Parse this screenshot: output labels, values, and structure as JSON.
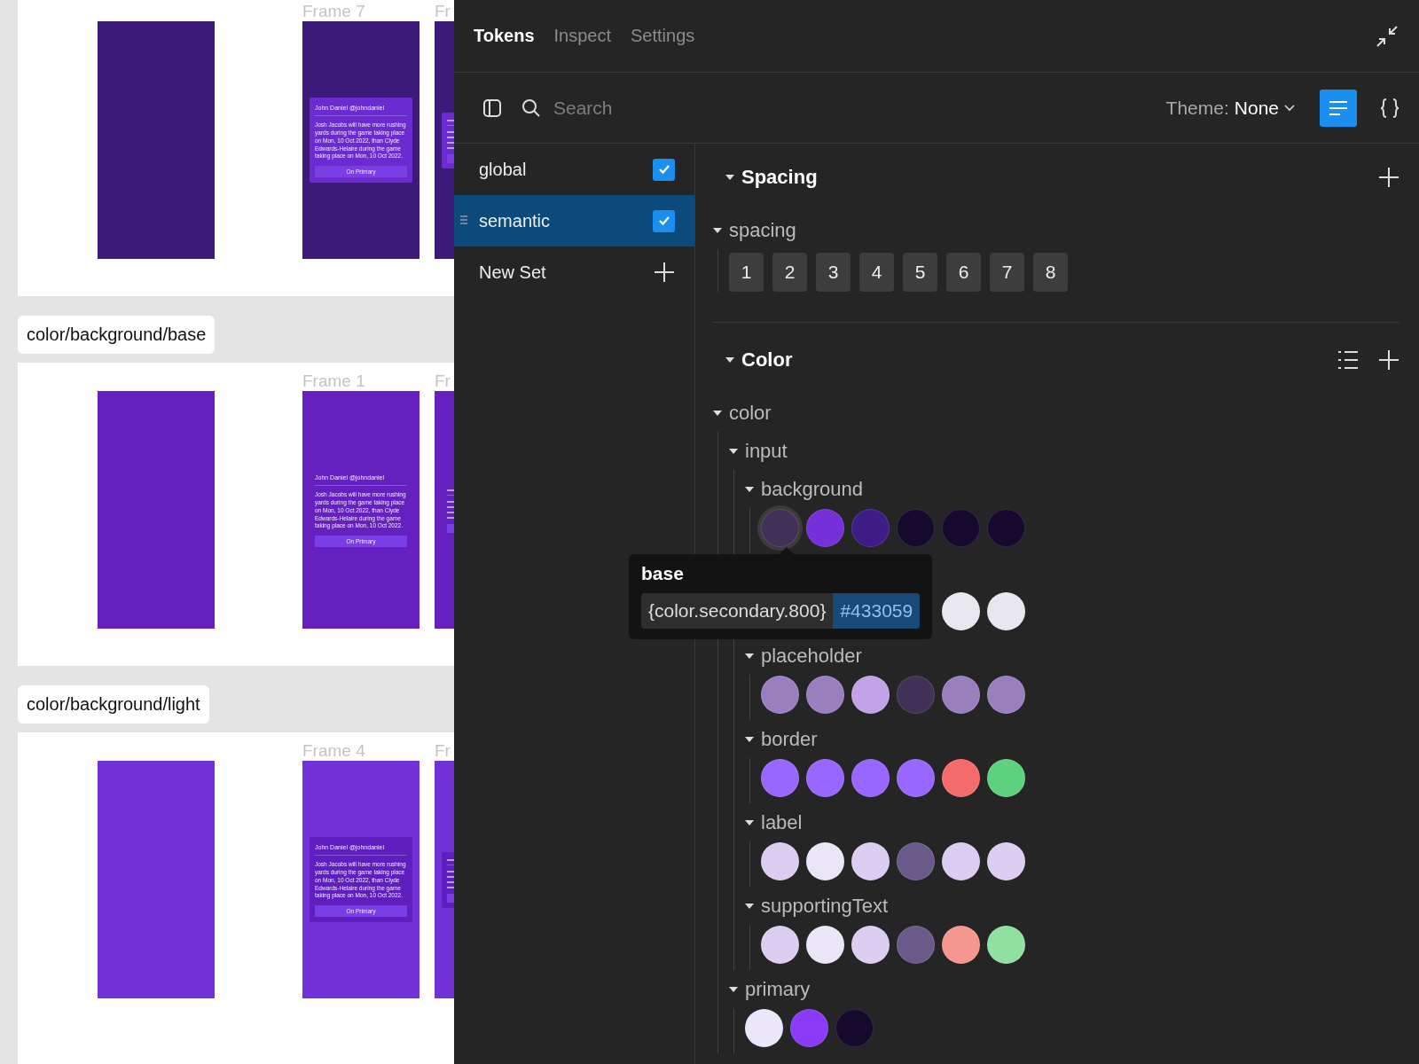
{
  "canvas": {
    "sections": [
      {
        "color": "#3c1a7a",
        "card": {
          "color": "#6a2bd0"
        },
        "frames": [
          {
            "label": "Frame 7",
            "card": {
              "author": "John Daniel @johndaniel",
              "body": "Josh Jacobs will have more rushing yards during the game taking place on Mon, 10 Oct 2022, than Clyde Edwards-Helaire during the game taking place on Mon, 10 Oct 2022.",
              "button": "On Primary"
            }
          },
          {
            "label": "Fr"
          }
        ]
      },
      {
        "label": "color/background/base",
        "color": "#6520c0",
        "card": {
          "color": "#6520c0"
        },
        "frames": [
          {
            "label": "Frame 1",
            "card": {
              "author": "John Daniel @johndaniel",
              "body": "Josh Jacobs will have more rushing yards during the game taking place on Mon, 10 Oct 2022, than Clyde Edwards-Helaire during the game taking place on Mon, 10 Oct 2022.",
              "button": "On Primary"
            }
          },
          {
            "label": "Fr"
          }
        ]
      },
      {
        "label": "color/background/light",
        "color": "#7232d8",
        "card": {
          "color": "#5e1fbe"
        },
        "frames": [
          {
            "label": "Frame 4",
            "card": {
              "author": "John Daniel @johndaniel",
              "body": "Josh Jacobs will have more rushing yards during the game taking place on Mon, 10 Oct 2022, than Clyde Edwards-Helaire during the game taking place on Mon, 10 Oct 2022.",
              "button": "On Primary"
            }
          },
          {
            "label": "Fr"
          }
        ]
      }
    ]
  },
  "tabs": [
    {
      "label": "Tokens",
      "selected": true
    },
    {
      "label": "Inspect",
      "selected": false
    },
    {
      "label": "Settings",
      "selected": false
    }
  ],
  "search": {
    "placeholder": "Search"
  },
  "theme": {
    "label": "Theme:",
    "value": "None"
  },
  "views": [
    {
      "kind": "list",
      "selected": true
    },
    {
      "kind": "json",
      "selected": false
    }
  ],
  "token_sets": [
    {
      "name": "global",
      "checked": true,
      "selected": false
    },
    {
      "name": "semantic",
      "checked": true,
      "selected": true
    }
  ],
  "new_set": {
    "label": "New Set"
  },
  "sections": [
    {
      "title": "Spacing",
      "expanded": true,
      "list_button": false,
      "children": [
        {
          "name": "spacing",
          "expanded": true,
          "tokens": [
            "1",
            "2",
            "3",
            "4",
            "5",
            "6",
            "7",
            "8"
          ]
        }
      ]
    },
    {
      "title": "Color",
      "expanded": true,
      "list_button": true,
      "children": [
        {
          "name": "color",
          "expanded": true,
          "children": [
            {
              "name": "input",
              "expanded": true,
              "children": [
                {
                  "name": "background",
                  "expanded": true,
                  "swatches": [
                    {
                      "color": "#433059"
                    },
                    {
                      "color": "#7530d9"
                    },
                    {
                      "color": "#3e1c85"
                    },
                    {
                      "color": "#150a2e"
                    },
                    {
                      "color": "#150a2e"
                    },
                    {
                      "color": "#150a2e"
                    }
                  ]
                },
                {
                  "swatches": [
                    {
                      "color": "#e8e8ee"
                    },
                    {
                      "color": "#e8e6ee"
                    }
                  ]
                },
                {
                  "name": "placeholder",
                  "expanded": true,
                  "swatches": [
                    {
                      "color": "#9a7fbf"
                    },
                    {
                      "color": "#9a7fbf"
                    },
                    {
                      "color": "#c3a3e8"
                    },
                    {
                      "color": "#433059"
                    },
                    {
                      "color": "#9a7fbf"
                    },
                    {
                      "color": "#9a7fbf"
                    }
                  ]
                },
                {
                  "name": "border",
                  "expanded": true,
                  "swatches": [
                    {
                      "color": "#9966ff"
                    },
                    {
                      "color": "#9966ff"
                    },
                    {
                      "color": "#9966ff"
                    },
                    {
                      "color": "#9966ff"
                    },
                    {
                      "color": "#f56b6b"
                    },
                    {
                      "color": "#5dd27e"
                    }
                  ]
                },
                {
                  "name": "label",
                  "expanded": true,
                  "swatches": [
                    {
                      "color": "#dccdf2"
                    },
                    {
                      "color": "#ebe6f7"
                    },
                    {
                      "color": "#dccdf2"
                    },
                    {
                      "color": "#6a5a8a"
                    },
                    {
                      "color": "#dccdf2"
                    },
                    {
                      "color": "#dccdf2"
                    }
                  ]
                },
                {
                  "name": "supportingText",
                  "expanded": true,
                  "swatches": [
                    {
                      "color": "#dccdf2"
                    },
                    {
                      "color": "#ebe6f7"
                    },
                    {
                      "color": "#dccdf2"
                    },
                    {
                      "color": "#6a5a8a"
                    },
                    {
                      "color": "#f5978f"
                    },
                    {
                      "color": "#90e0a0"
                    }
                  ]
                }
              ]
            },
            {
              "name": "primary",
              "expanded": true,
              "swatches": [
                {
                  "color": "#ece6fb"
                },
                {
                  "color": "#8a3cf5"
                },
                {
                  "color": "#150a2e"
                }
              ]
            }
          ]
        }
      ]
    }
  ],
  "tooltip": {
    "title": "base",
    "reference": "{color.secondary.800}",
    "value": "#433059"
  }
}
